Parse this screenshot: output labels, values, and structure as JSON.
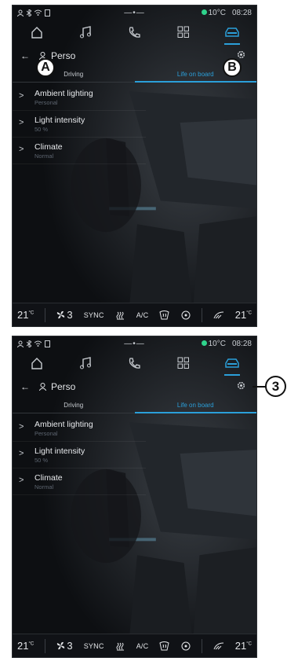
{
  "screens": [
    {
      "status": {
        "center": "—•—",
        "temp": "10°C",
        "time": "08:28"
      },
      "header": {
        "title": "Perso"
      },
      "tabs": [
        "Driving",
        "Life on board"
      ],
      "menu": [
        {
          "title": "Ambient lighting",
          "sub": "Personal"
        },
        {
          "title": "Light intensity",
          "sub": "50 %"
        },
        {
          "title": "Climate",
          "sub": "Normal"
        }
      ],
      "bottom": {
        "temp_left": "21",
        "temp_unit": "°C",
        "fan": "3",
        "sync": "SYNC",
        "ac": "A/C",
        "temp_right": "21"
      }
    },
    {
      "status": {
        "center": "—•—",
        "temp": "10°C",
        "time": "08:28"
      },
      "header": {
        "title": "Perso"
      },
      "tabs": [
        "Driving",
        "Life on board"
      ],
      "menu": [
        {
          "title": "Ambient lighting",
          "sub": "Personal"
        },
        {
          "title": "Light intensity",
          "sub": "50 %"
        },
        {
          "title": "Climate",
          "sub": "Normal"
        }
      ],
      "bottom": {
        "temp_left": "21",
        "temp_unit": "°C",
        "fan": "3",
        "sync": "SYNC",
        "ac": "A/C",
        "temp_right": "21"
      }
    }
  ],
  "callouts": {
    "a": "A",
    "b": "B",
    "c": "3"
  },
  "colors": {
    "accent": "#2b9fd9",
    "status_dot": "#2fd38c",
    "background": "#0d0f12"
  },
  "icons": [
    "home-icon",
    "music-icon",
    "phone-icon",
    "apps-icon",
    "car-icon",
    "gear-icon",
    "user-icon",
    "back-arrow-icon",
    "chevron-right-icon",
    "fan-icon",
    "seat-heat-icon",
    "steering-wheel-heat-icon",
    "rear-defrost-icon",
    "windshield-defrost-icon"
  ]
}
